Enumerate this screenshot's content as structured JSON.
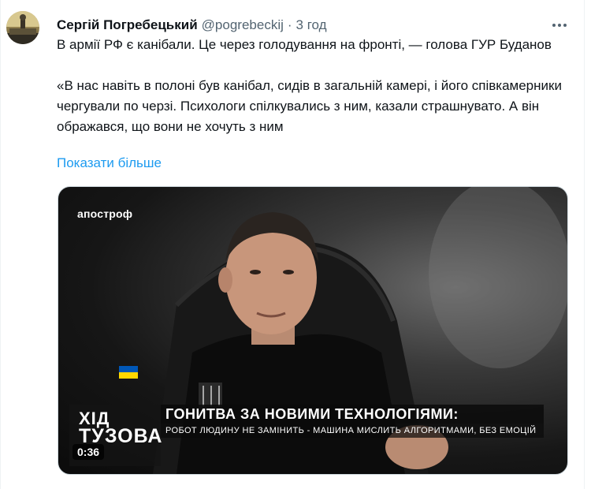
{
  "tweet": {
    "author_name": "Сергій Погребецький",
    "author_handle": "@pogrebeckij",
    "separator": "·",
    "time": "3 год",
    "text_p1": "В армії РФ є канібали. Це через голодування на фронті, — голова ГУР Буданов",
    "text_p2": "«В нас навіть в полоні був канібал, сидів в загальній камері, і його співкамерники чергували по черзі. Психологи спілкувались з ним, казали страшнувато. А він ображався, що вони не хочуть з ним",
    "show_more": "Показати більше"
  },
  "media": {
    "channel_logo": "апостроф",
    "show_name_line1": "ХІД",
    "show_name_line2": "ТУЗОВА",
    "headline": "ГОНИТВА ЗА НОВИМИ ТЕХНОЛОГІЯМИ:",
    "subheadline": "РОБОТ ЛЮДИНУ НЕ ЗАМІНИТЬ - МАШИНА МИСЛИТЬ АЛГОРИТМАМИ, БЕЗ ЕМОЦІЙ",
    "duration": "0:36"
  },
  "icons": {
    "more": "more-horizontal-icon",
    "flag": "ukraine-flag-patch-icon"
  },
  "colors": {
    "link": "#1d9bf0",
    "secondary_text": "#536471",
    "primary_text": "#0f1419",
    "flag_blue": "#0057b7",
    "flag_yellow": "#ffd700"
  }
}
